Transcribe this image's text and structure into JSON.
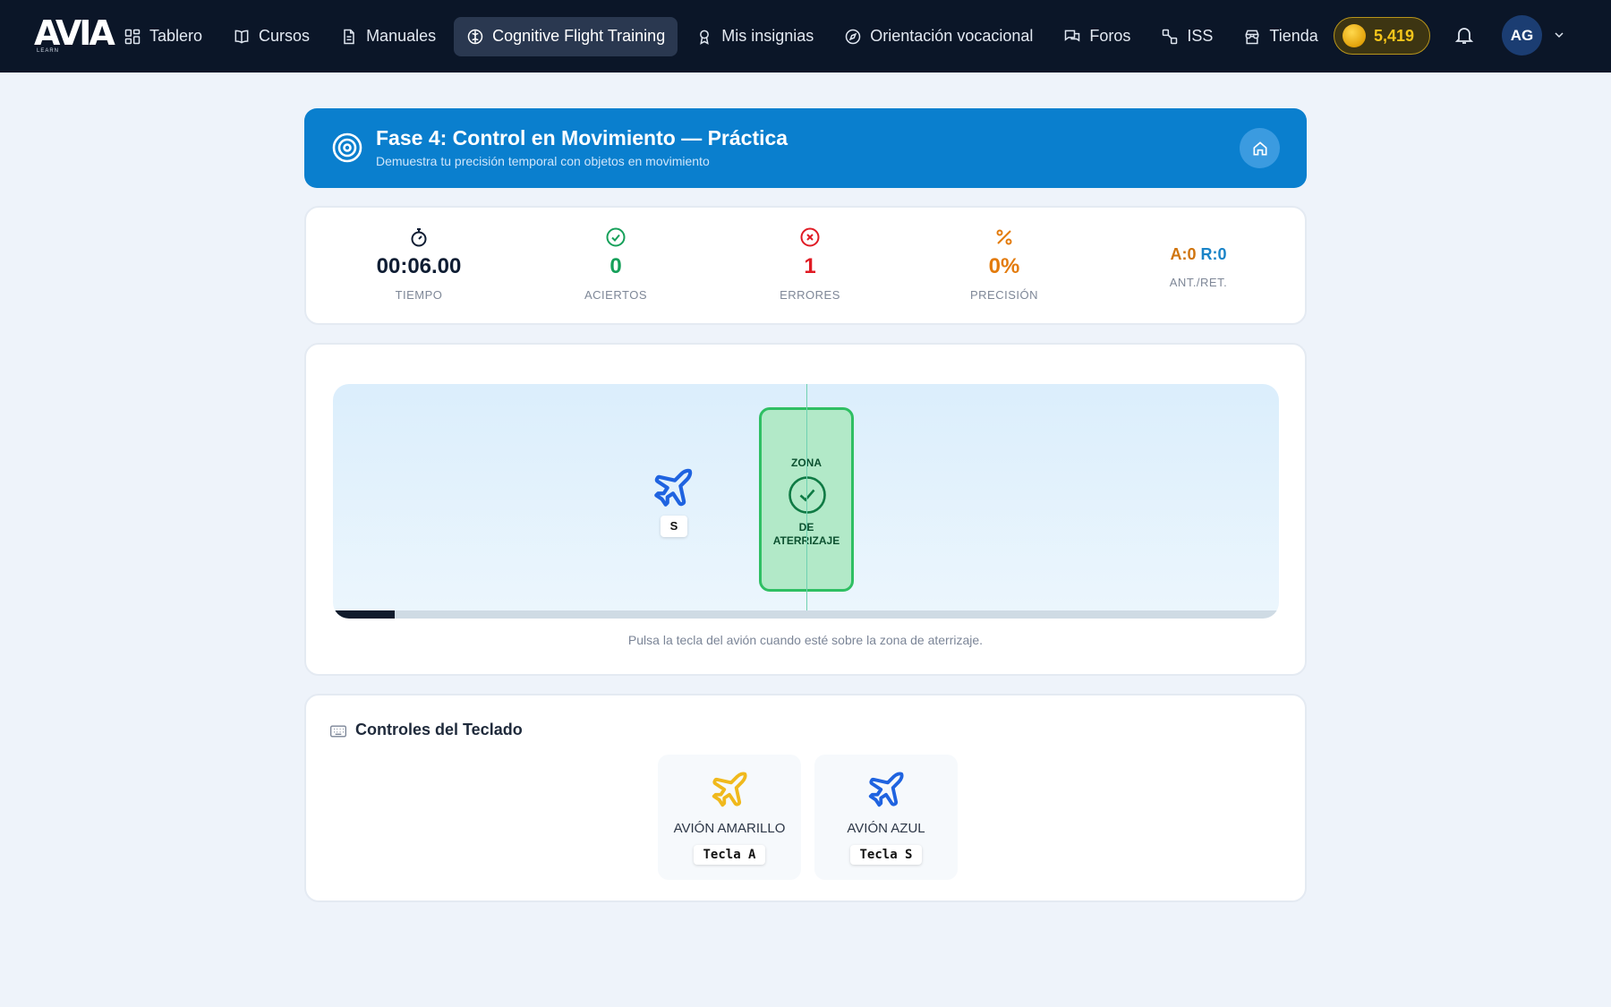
{
  "nav": {
    "logo": "AVIA",
    "logo_sub": "LEARN",
    "items": [
      {
        "label": "Tablero",
        "icon": "dashboard-icon"
      },
      {
        "label": "Cursos",
        "icon": "book-icon"
      },
      {
        "label": "Manuales",
        "icon": "document-icon"
      },
      {
        "label": "Cognitive Flight Training",
        "icon": "brain-icon",
        "active": true
      },
      {
        "label": "Mis insignias",
        "icon": "badge-icon"
      },
      {
        "label": "Orientación vocacional",
        "icon": "compass-icon"
      },
      {
        "label": "Foros",
        "icon": "chat-icon"
      },
      {
        "label": "ISS",
        "icon": "satellite-icon"
      },
      {
        "label": "Tienda",
        "icon": "store-icon"
      }
    ],
    "coins": "5,419",
    "avatar_initials": "AG"
  },
  "header": {
    "title": "Fase 4: Control en Movimiento — Práctica",
    "subtitle": "Demuestra tu precisión temporal con objetos en movimiento"
  },
  "stats": {
    "time": {
      "value": "00:06.00",
      "label": "TIEMPO"
    },
    "hits": {
      "value": "0",
      "label": "ACIERTOS"
    },
    "errors": {
      "value": "1",
      "label": "ERRORES"
    },
    "precision": {
      "value": "0%",
      "label": "PRECISIÓN"
    },
    "early_late": {
      "early": "A:0",
      "late": "R:0",
      "label": "ANT./RET."
    }
  },
  "game": {
    "zone_line1": "ZONA",
    "zone_line2": "DE",
    "zone_line3": "ATERRIZAJE",
    "plane_key": "S",
    "progress": 0.065,
    "hint": "Pulsa la tecla del avión cuando esté sobre la zona de aterrizaje."
  },
  "controls": {
    "title": "Controles del Teclado",
    "cards": [
      {
        "name": "AVIÓN AMARILLO",
        "key": "Tecla A",
        "color": "#f0b91c"
      },
      {
        "name": "AVIÓN AZUL",
        "key": "Tecla S",
        "color": "#1f63e0"
      }
    ]
  },
  "colors": {
    "nav_bg": "#0b1628",
    "banner": "#0a7fce",
    "success": "#16a05a",
    "error": "#e01b24",
    "warning": "#e37b0c",
    "info": "#1a84c8"
  }
}
